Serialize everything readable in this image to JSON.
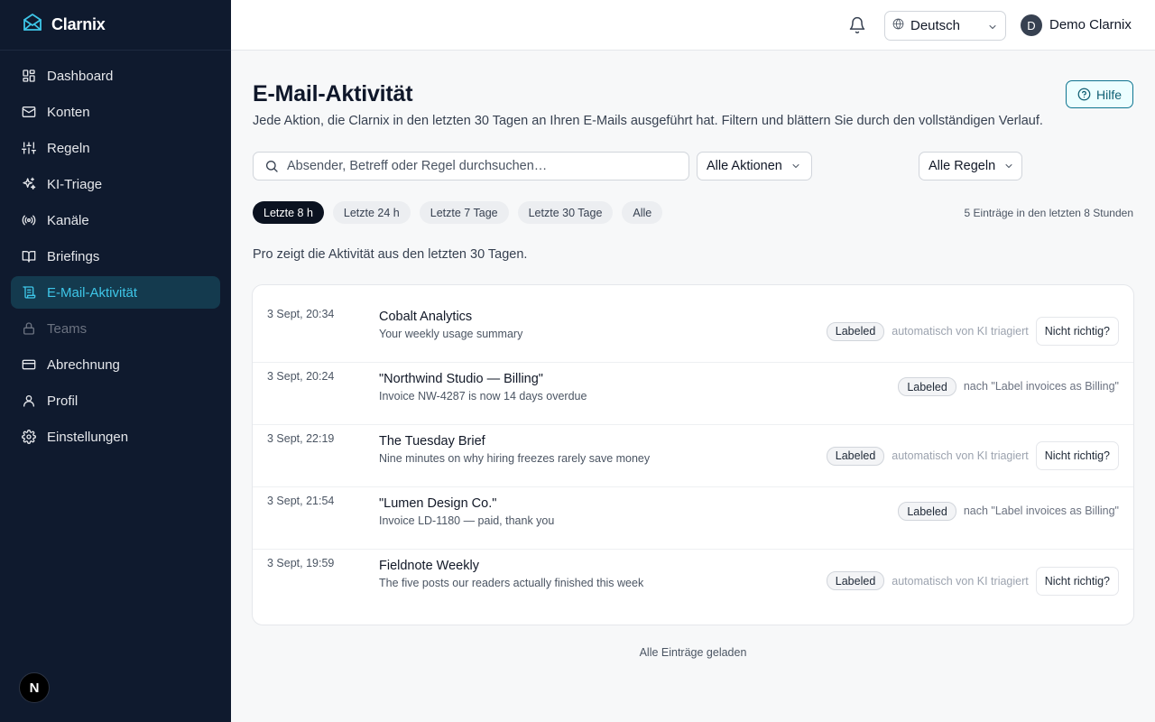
{
  "brand": {
    "name": "Clarnix"
  },
  "sidebar": {
    "items": [
      {
        "label": "Dashboard",
        "icon": "grid-icon",
        "state": "normal"
      },
      {
        "label": "Konten",
        "icon": "mail-icon",
        "state": "normal"
      },
      {
        "label": "Regeln",
        "icon": "sliders-icon",
        "state": "normal"
      },
      {
        "label": "KI-Triage",
        "icon": "sparkles-icon",
        "state": "normal"
      },
      {
        "label": "Kanäle",
        "icon": "radio-icon",
        "state": "normal"
      },
      {
        "label": "Briefings",
        "icon": "book-icon",
        "state": "normal"
      },
      {
        "label": "E-Mail-Aktivität",
        "icon": "scroll-icon",
        "state": "active"
      },
      {
        "label": "Teams",
        "icon": "lock-icon",
        "state": "disabled"
      },
      {
        "label": "Abrechnung",
        "icon": "credit-card-icon",
        "state": "normal"
      },
      {
        "label": "Profil",
        "icon": "user-icon",
        "state": "normal"
      },
      {
        "label": "Einstellungen",
        "icon": "gear-icon",
        "state": "normal"
      }
    ],
    "bottom_badge": "N"
  },
  "header": {
    "language": "Deutsch",
    "user_initial": "D",
    "user_name": "Demo Clarnix"
  },
  "main": {
    "title": "E-Mail-Aktivität",
    "subtitle": "Jede Aktion, die Clarnix in den letzten 30 Tagen an Ihren E-Mails ausgeführt hat. Filtern und blättern Sie durch den vollständigen Verlauf.",
    "help_label": "Hilfe",
    "search_placeholder": "Absender, Betreff oder Regel durchsuchen…",
    "actions_filter": "Alle Aktionen",
    "rules_filter": "Alle Regeln",
    "time_chips": [
      {
        "label": "Letzte 8 h",
        "active": true
      },
      {
        "label": "Letzte 24 h",
        "active": false
      },
      {
        "label": "Letzte 7 Tage",
        "active": false
      },
      {
        "label": "Letzte 30 Tage",
        "active": false
      },
      {
        "label": "Alle",
        "active": false
      }
    ],
    "entry_count": "5 Einträge in den letzten 8 Stunden",
    "pro_note": "Pro zeigt die Aktivität aus den letzten 30 Tagen.",
    "rows": [
      {
        "time": "3 Sept, 20:34",
        "sender": "Cobalt Analytics",
        "subject": "Your weekly usage summary",
        "badge": "Labeled",
        "meta": "automatisch von KI triagiert",
        "meta_type": "ai",
        "action": "Nicht richtig?"
      },
      {
        "time": "3 Sept, 20:24",
        "sender": "\"Northwind Studio — Billing\"",
        "subject": "Invoice NW-4287 is now 14 days overdue",
        "badge": "Labeled",
        "meta": "nach \"Label invoices as Billing\"",
        "meta_type": "rule",
        "action": ""
      },
      {
        "time": "3 Sept, 22:19",
        "sender": "The Tuesday Brief",
        "subject": "Nine minutes on why hiring freezes rarely save money",
        "badge": "Labeled",
        "meta": "automatisch von KI triagiert",
        "meta_type": "ai",
        "action": "Nicht richtig?"
      },
      {
        "time": "3 Sept, 21:54",
        "sender": "\"Lumen Design Co.\"",
        "subject": "Invoice LD-1180 — paid, thank you",
        "badge": "Labeled",
        "meta": "nach \"Label invoices as Billing\"",
        "meta_type": "rule",
        "action": ""
      },
      {
        "time": "3 Sept, 19:59",
        "sender": "Fieldnote Weekly",
        "subject": "The five posts our readers actually finished this week",
        "badge": "Labeled",
        "meta": "automatisch von KI triagiert",
        "meta_type": "ai",
        "action": "Nicht richtig?"
      }
    ],
    "footer": "Alle Einträge geladen"
  },
  "colors": {
    "sidebar_bg": "#0f1a2e",
    "active_bg": "#143a4e",
    "accent": "#3ec6e8",
    "help_accent": "#0e7490"
  }
}
